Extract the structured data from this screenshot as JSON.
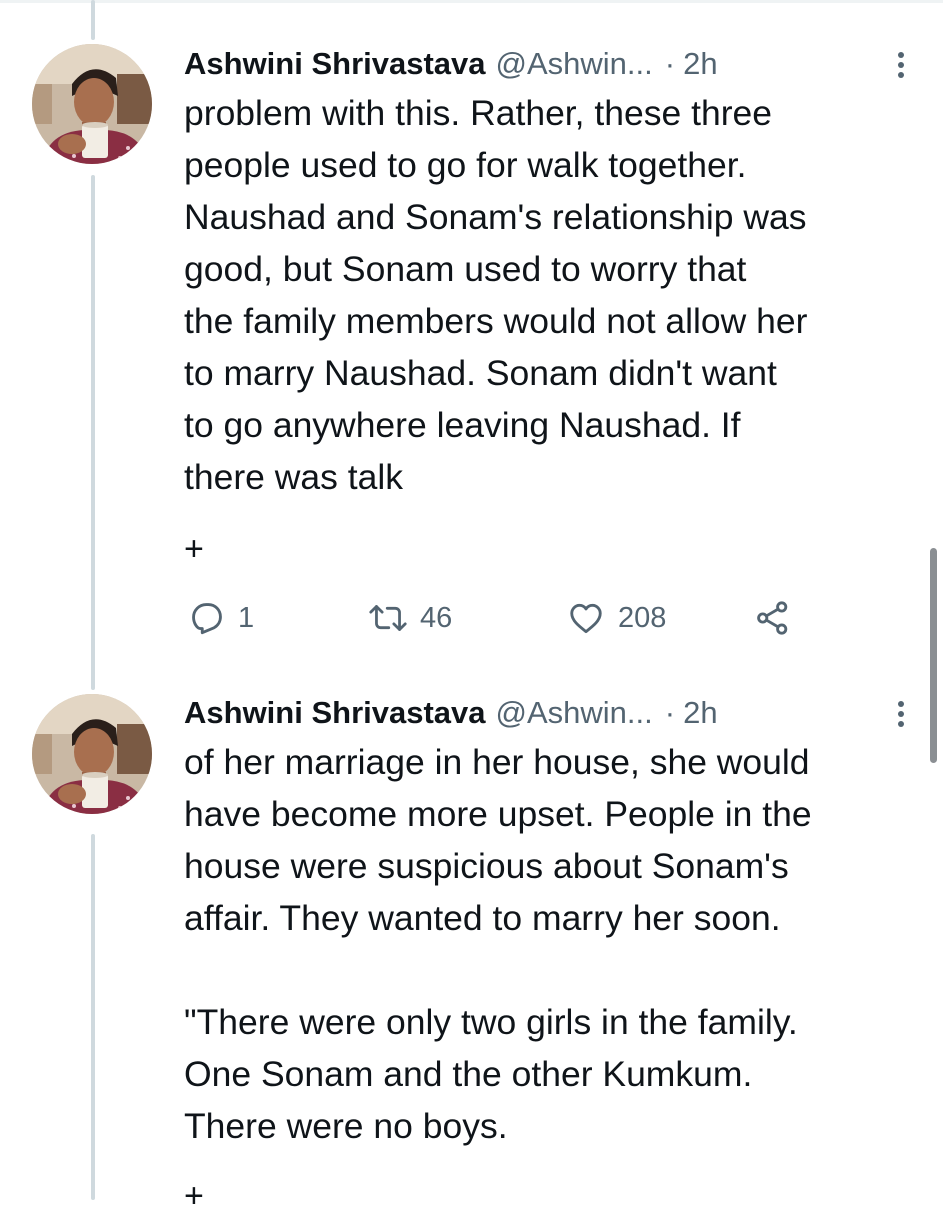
{
  "tweets": [
    {
      "author_name": "Ashwini Shrivastava",
      "handle": "@Ashwin...",
      "separator": "·",
      "time": "2h",
      "text": "problem with this. Rather, these three\npeople used to go for walk together.\nNaushad and Sonam's relationship was\ngood, but Sonam used to worry that\nthe family members would not allow her\nto marry Naushad. Sonam didn't want\nto go anywhere leaving Naushad. If\nthere was talk",
      "continuation_mark": "+",
      "replies": "1",
      "retweets": "46",
      "likes": "208"
    },
    {
      "author_name": "Ashwini Shrivastava",
      "handle": "@Ashwin...",
      "separator": "·",
      "time": "2h",
      "text": "of her marriage in her house, she would\nhave become more upset. People in the\nhouse were suspicious about Sonam's\naffair. They wanted to marry her soon.\n\n\"There were only two girls in the family.\nOne Sonam and the other Kumkum.\nThere were no boys.",
      "continuation_mark": "+"
    }
  ],
  "icons": {
    "more": "more-vertical-icon",
    "reply": "reply-icon",
    "retweet": "retweet-icon",
    "like": "heart-icon",
    "share": "share-icon"
  },
  "colors": {
    "text": "#0f1419",
    "secondary": "#536471",
    "thread_line": "#cfd9de"
  }
}
